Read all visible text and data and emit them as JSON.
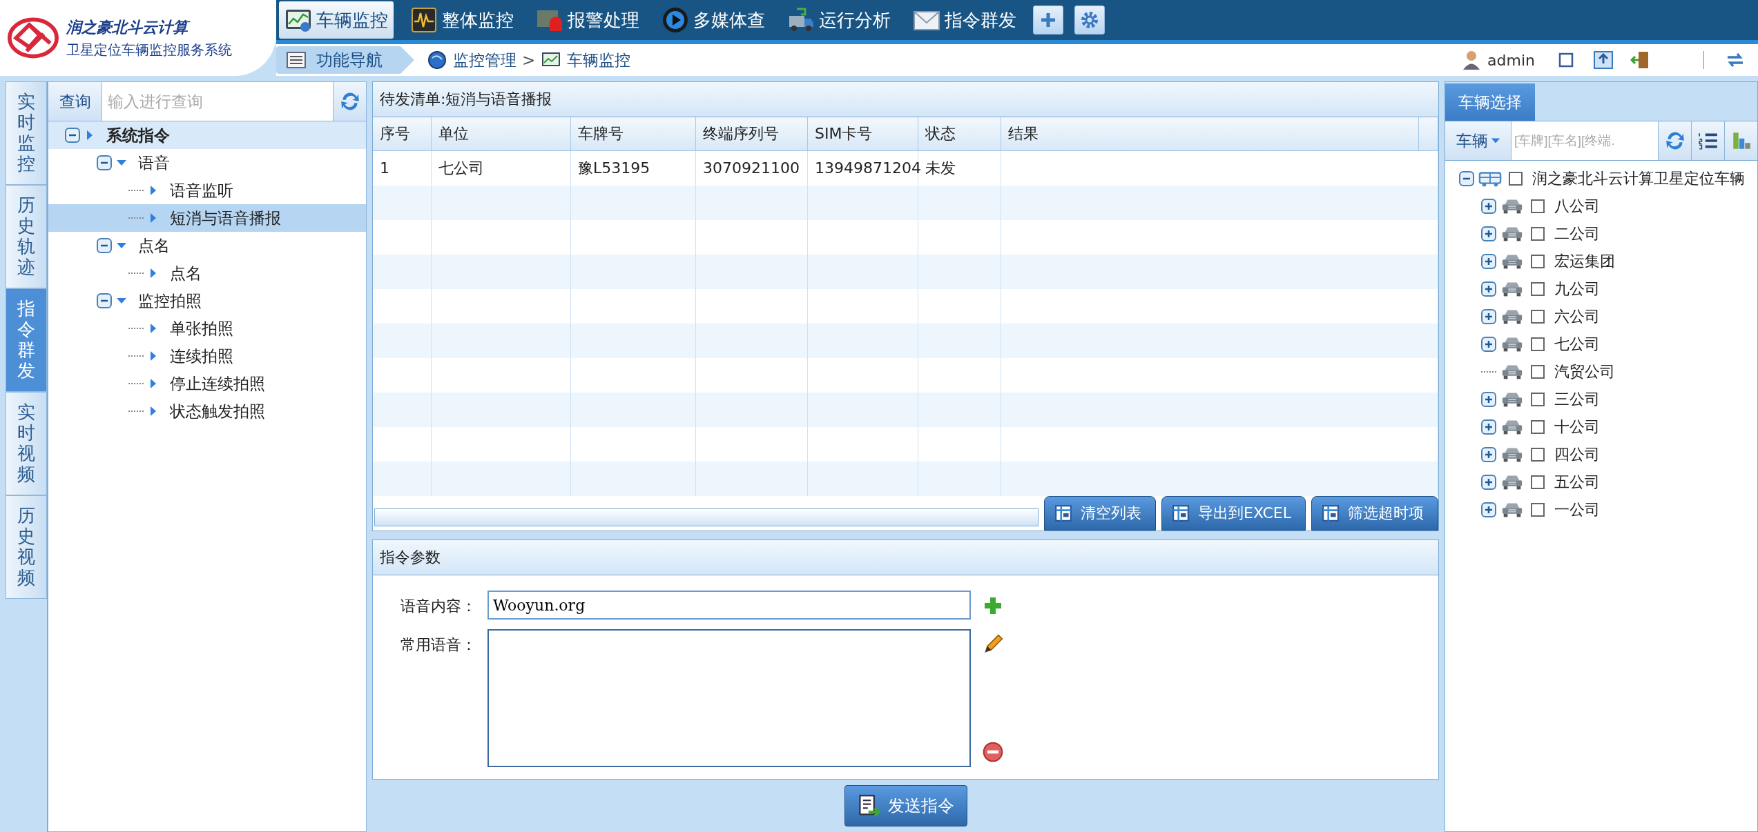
{
  "header": {
    "logo_title": "润之豪北斗云计算",
    "logo_subtitle": "卫星定位车辆监控服务系统",
    "nav_tabs": [
      {
        "label": "车辆监控",
        "selected": true
      },
      {
        "label": "整体监控",
        "selected": false
      },
      {
        "label": "报警处理",
        "selected": false
      },
      {
        "label": "多媒体查",
        "selected": false
      },
      {
        "label": "运行分析",
        "selected": false
      },
      {
        "label": "指令群发",
        "selected": false
      }
    ],
    "nav_label": "功能导航",
    "breadcrumb": [
      {
        "label": "监控管理"
      },
      {
        "label": "车辆监控"
      }
    ],
    "breadcrumb_separator": ">",
    "user": "admin"
  },
  "side_tabs": [
    {
      "label": "实时监控",
      "selected": false
    },
    {
      "label": "历史轨迹",
      "selected": false
    },
    {
      "label": "指令群发",
      "selected": true
    },
    {
      "label": "实时视频",
      "selected": false
    },
    {
      "label": "历史视频",
      "selected": false
    }
  ],
  "command_tree": {
    "search_button": "查询",
    "search_placeholder": "输入进行查询",
    "items": [
      {
        "label": "系统指令",
        "expanded": true,
        "selected": false,
        "children": [
          {
            "label": "语音",
            "expanded": true,
            "selected": false,
            "children": [
              {
                "label": "语音监听",
                "selected": false
              },
              {
                "label": "短消与语音播报",
                "selected": true
              }
            ]
          },
          {
            "label": "点名",
            "expanded": true,
            "selected": false,
            "children": [
              {
                "label": "点名",
                "selected": false
              }
            ]
          },
          {
            "label": "监控拍照",
            "expanded": true,
            "selected": false,
            "children": [
              {
                "label": "单张拍照",
                "selected": false
              },
              {
                "label": "连续拍照",
                "selected": false
              },
              {
                "label": "停止连续拍照",
                "selected": false
              },
              {
                "label": "状态触发拍照",
                "selected": false
              }
            ]
          }
        ]
      }
    ]
  },
  "pending_list": {
    "title": "待发清单:短消与语音播报",
    "columns": [
      "序号",
      "单位",
      "车牌号",
      "终端序列号",
      "SIM卡号",
      "状态",
      "结果"
    ],
    "rows": [
      {
        "cells": [
          "1",
          "七公司",
          "豫L53195",
          "3070921100",
          "13949871204",
          "未发"
        ]
      }
    ],
    "buttons": [
      "清空列表",
      "导出到EXCEL",
      "筛选超时项"
    ]
  },
  "params": {
    "title": "指令参数",
    "content_label": "语音内容：",
    "content_value": "Wooyun.org",
    "common_label": "常用语音："
  },
  "send_button": "发送指令",
  "vehicle_panel": {
    "tab": "车辆选择",
    "filter_label": "车辆",
    "search_placeholder": "[车牌][车名][终端.",
    "tree": [
      {
        "label": "润之豪北斗云计算卫星定位车辆",
        "expanded": true,
        "checked": false,
        "children": [
          {
            "label": "八公司",
            "expanded": false,
            "checked": false
          },
          {
            "label": "二公司",
            "expanded": false,
            "checked": false
          },
          {
            "label": "宏运集团",
            "expanded": false,
            "checked": false
          },
          {
            "label": "九公司",
            "expanded": false,
            "checked": false
          },
          {
            "label": "六公司",
            "expanded": false,
            "checked": false
          },
          {
            "label": "七公司",
            "expanded": false,
            "checked": false
          },
          {
            "label": "汽贸公司",
            "checked": false
          },
          {
            "label": "三公司",
            "expanded": false,
            "checked": false
          },
          {
            "label": "十公司",
            "expanded": false,
            "checked": false
          },
          {
            "label": "四公司",
            "expanded": false,
            "checked": false
          },
          {
            "label": "五公司",
            "expanded": false,
            "checked": false
          },
          {
            "label": "一公司",
            "expanded": false,
            "checked": false
          }
        ]
      }
    ]
  }
}
